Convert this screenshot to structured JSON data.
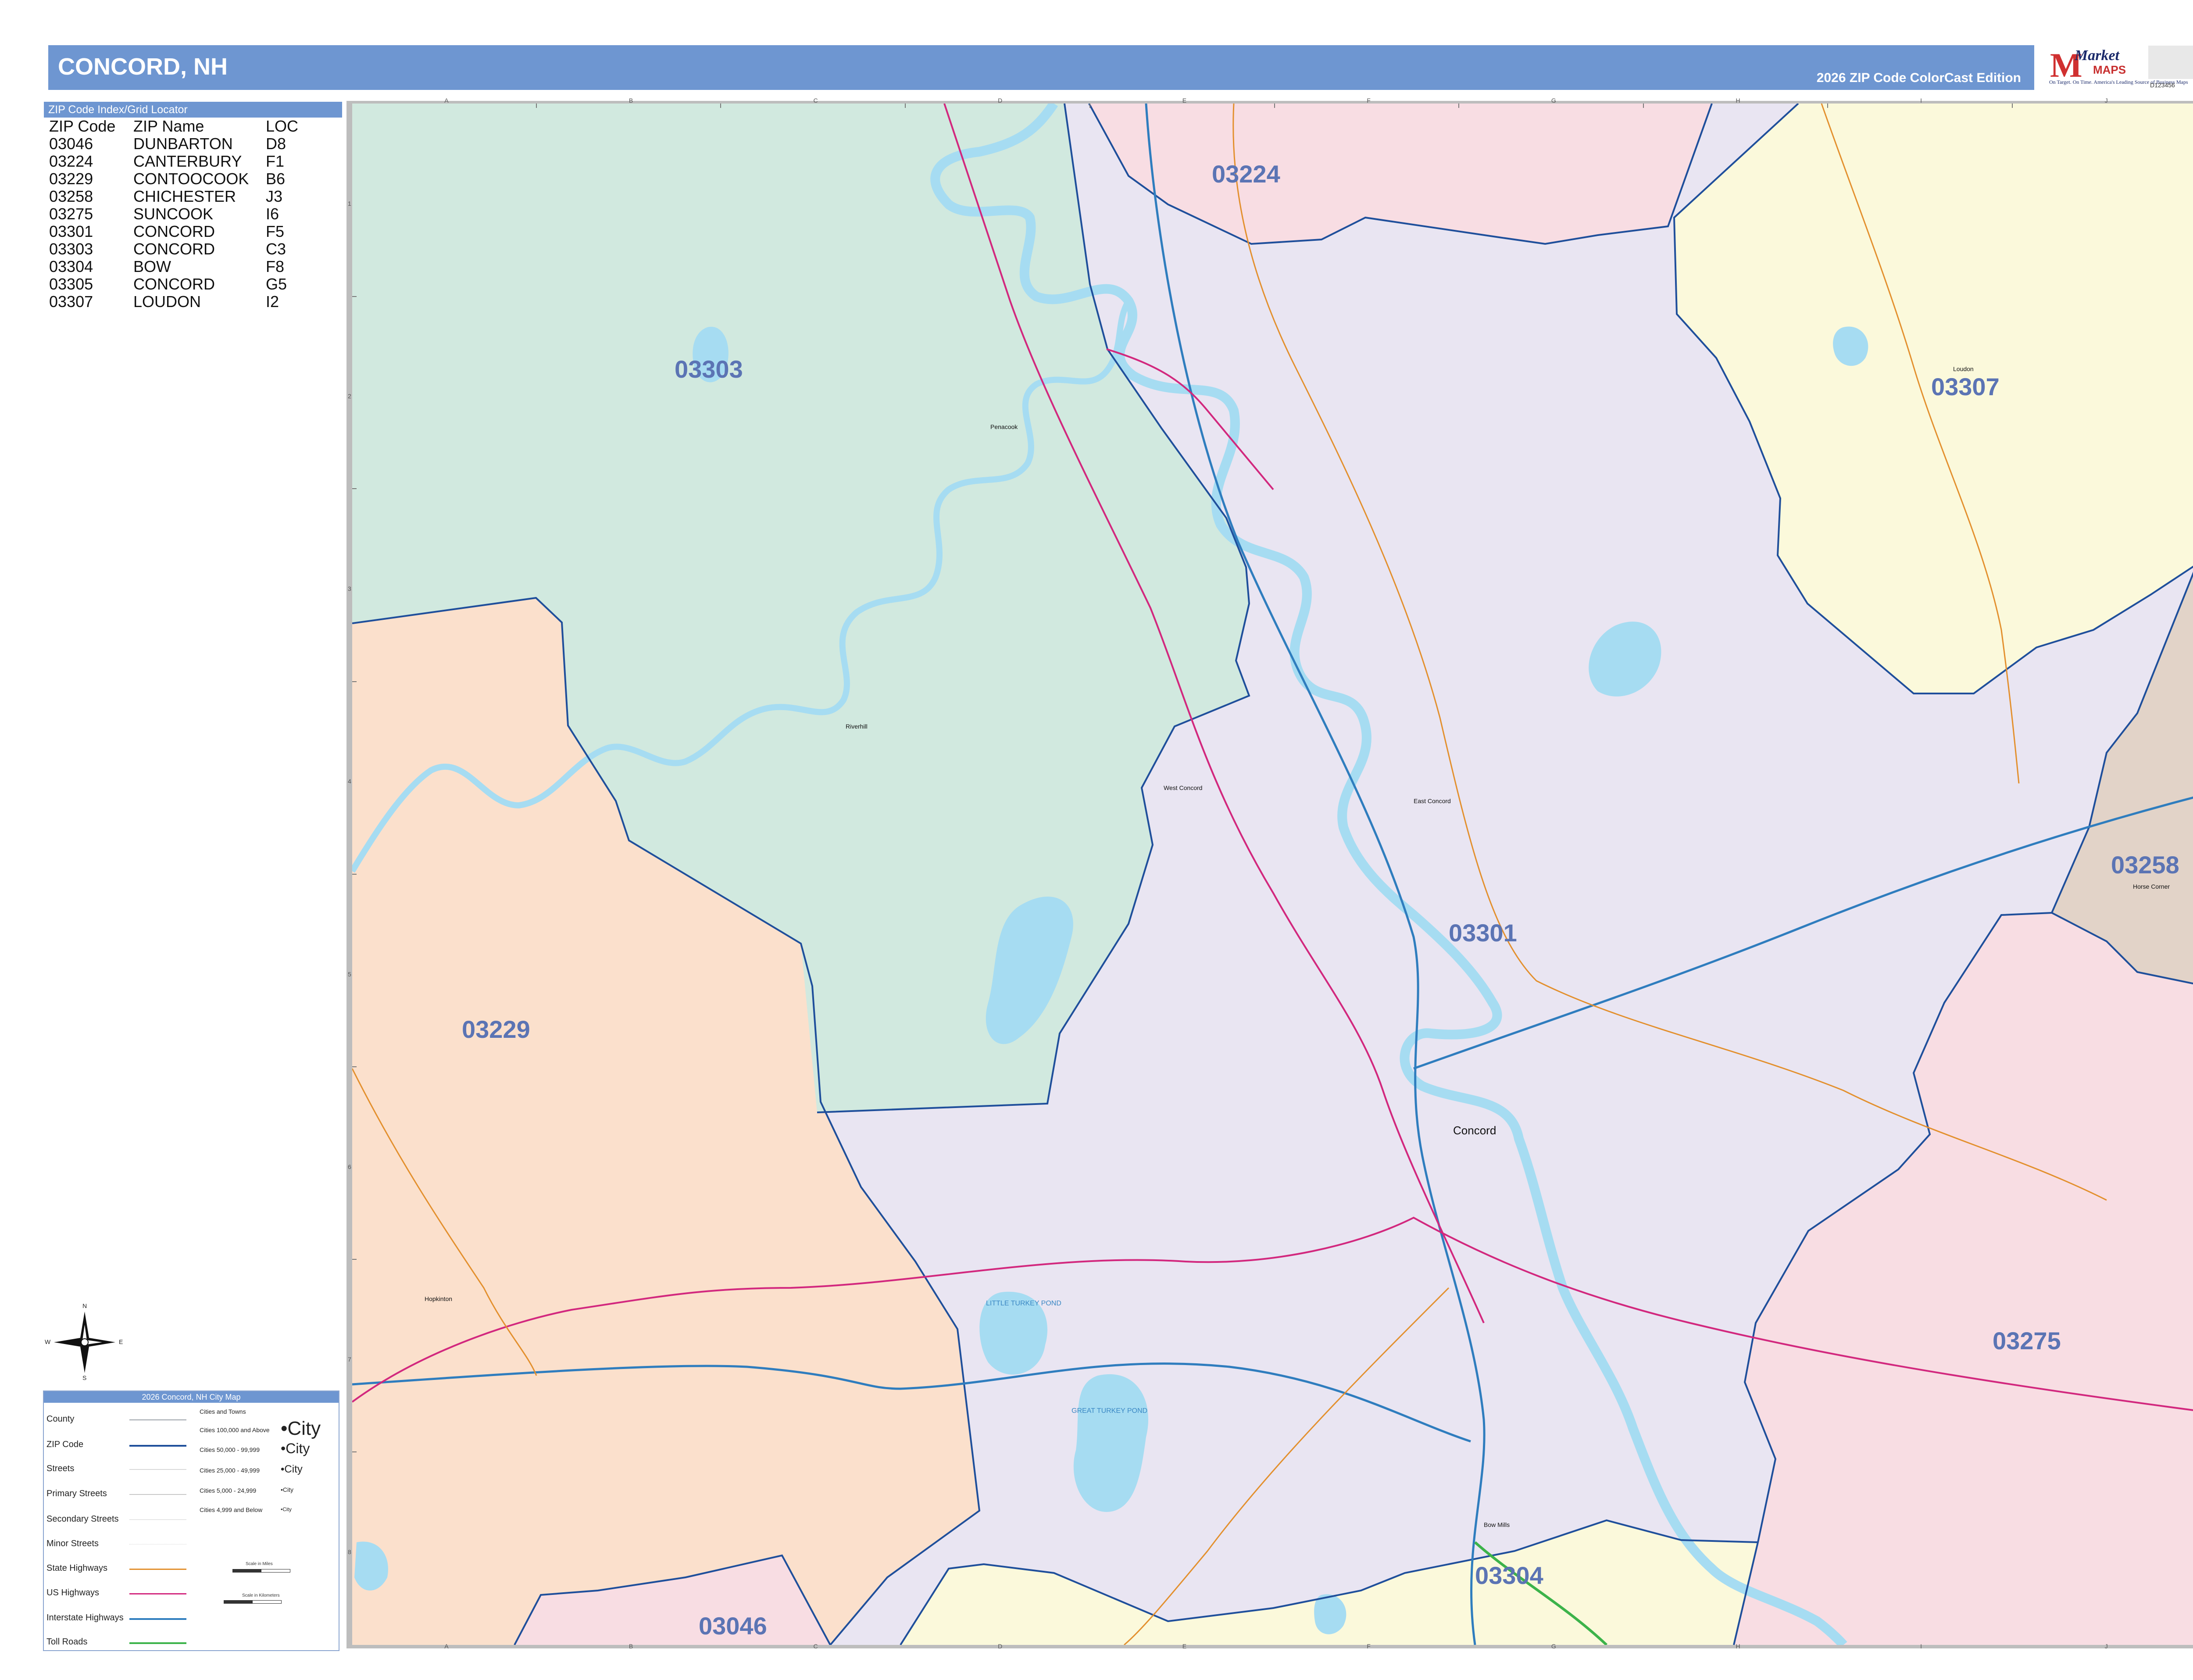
{
  "header": {
    "title": "CONCORD, NH",
    "edition": "2026 ZIP Code ColorCast Edition"
  },
  "logo": {
    "name_top": "Market",
    "name_bottom": "MAPS",
    "tagline": "America's Leading Source of Business Maps",
    "slogan": "On Target. On Time.",
    "product_code": "D123456"
  },
  "index": {
    "header": "ZIP Code Index/Grid Locator",
    "columns": [
      "ZIP Code",
      "ZIP Name",
      "LOC"
    ],
    "rows": [
      [
        "03046",
        "DUNBARTON",
        "D8"
      ],
      [
        "03224",
        "CANTERBURY",
        "F1"
      ],
      [
        "03229",
        "CONTOOCOOK",
        "B6"
      ],
      [
        "03258",
        "CHICHESTER",
        "J3"
      ],
      [
        "03275",
        "SUNCOOK",
        "I6"
      ],
      [
        "03301",
        "CONCORD",
        "F5"
      ],
      [
        "03303",
        "CONCORD",
        "C3"
      ],
      [
        "03304",
        "BOW",
        "F8"
      ],
      [
        "03305",
        "CONCORD",
        "G5"
      ],
      [
        "03307",
        "LOUDON",
        "I2"
      ]
    ]
  },
  "map": {
    "grid_columns": [
      "A",
      "B",
      "C",
      "D",
      "E",
      "F",
      "G",
      "H",
      "I",
      "J"
    ],
    "grid_rows": [
      "1",
      "2",
      "3",
      "4",
      "5",
      "6",
      "7",
      "8"
    ],
    "zip_colors": {
      "03303": "#d1e9df",
      "03224": "#f8dde3",
      "03307": "#fbf9db",
      "03301": "#e9e5f2",
      "03229": "#fbe0cc",
      "03258": "#e2d3c8",
      "03275": "#f8dde3",
      "03304": "#fbf9db",
      "03046": "#f8dde3"
    },
    "zip_labels": [
      "03303",
      "03224",
      "03307",
      "03301",
      "03229",
      "03258",
      "03275",
      "03304",
      "03046"
    ],
    "places": [
      "Concord",
      "Penacook",
      "Riverhill",
      "West Concord",
      "East Concord",
      "Loudon",
      "Horse Corner",
      "Hopkinton",
      "Bow Mills"
    ],
    "water_labels": [
      "LITTLE TURKEY POND",
      "GREAT TURKEY POND"
    ],
    "water_color": "#a6dcf2"
  },
  "compass": {
    "n": "N",
    "s": "S",
    "e": "E",
    "w": "W"
  },
  "legend": {
    "title": "2026 Concord, NH City Map",
    "items": [
      "County",
      "ZIP Code",
      "Streets",
      "Primary Streets",
      "Secondary Streets",
      "Minor Streets",
      "State Highways",
      "US Highways",
      "Interstate Highways",
      "Toll Roads"
    ],
    "cities_header": "Cities and Towns",
    "city_classes": [
      {
        "range": "Cities 100,000 and Above",
        "sample": "City"
      },
      {
        "range": "Cities 50,000 - 99,999",
        "sample": "City"
      },
      {
        "range": "Cities 25,000 - 49,999",
        "sample": "City"
      },
      {
        "range": "Cities 5,000 - 24,999",
        "sample": "City"
      },
      {
        "range": "Cities 4,999 and Below",
        "sample": "City"
      }
    ],
    "scale_miles": "Scale in Miles",
    "scale_km": "Scale in Kilometers"
  }
}
